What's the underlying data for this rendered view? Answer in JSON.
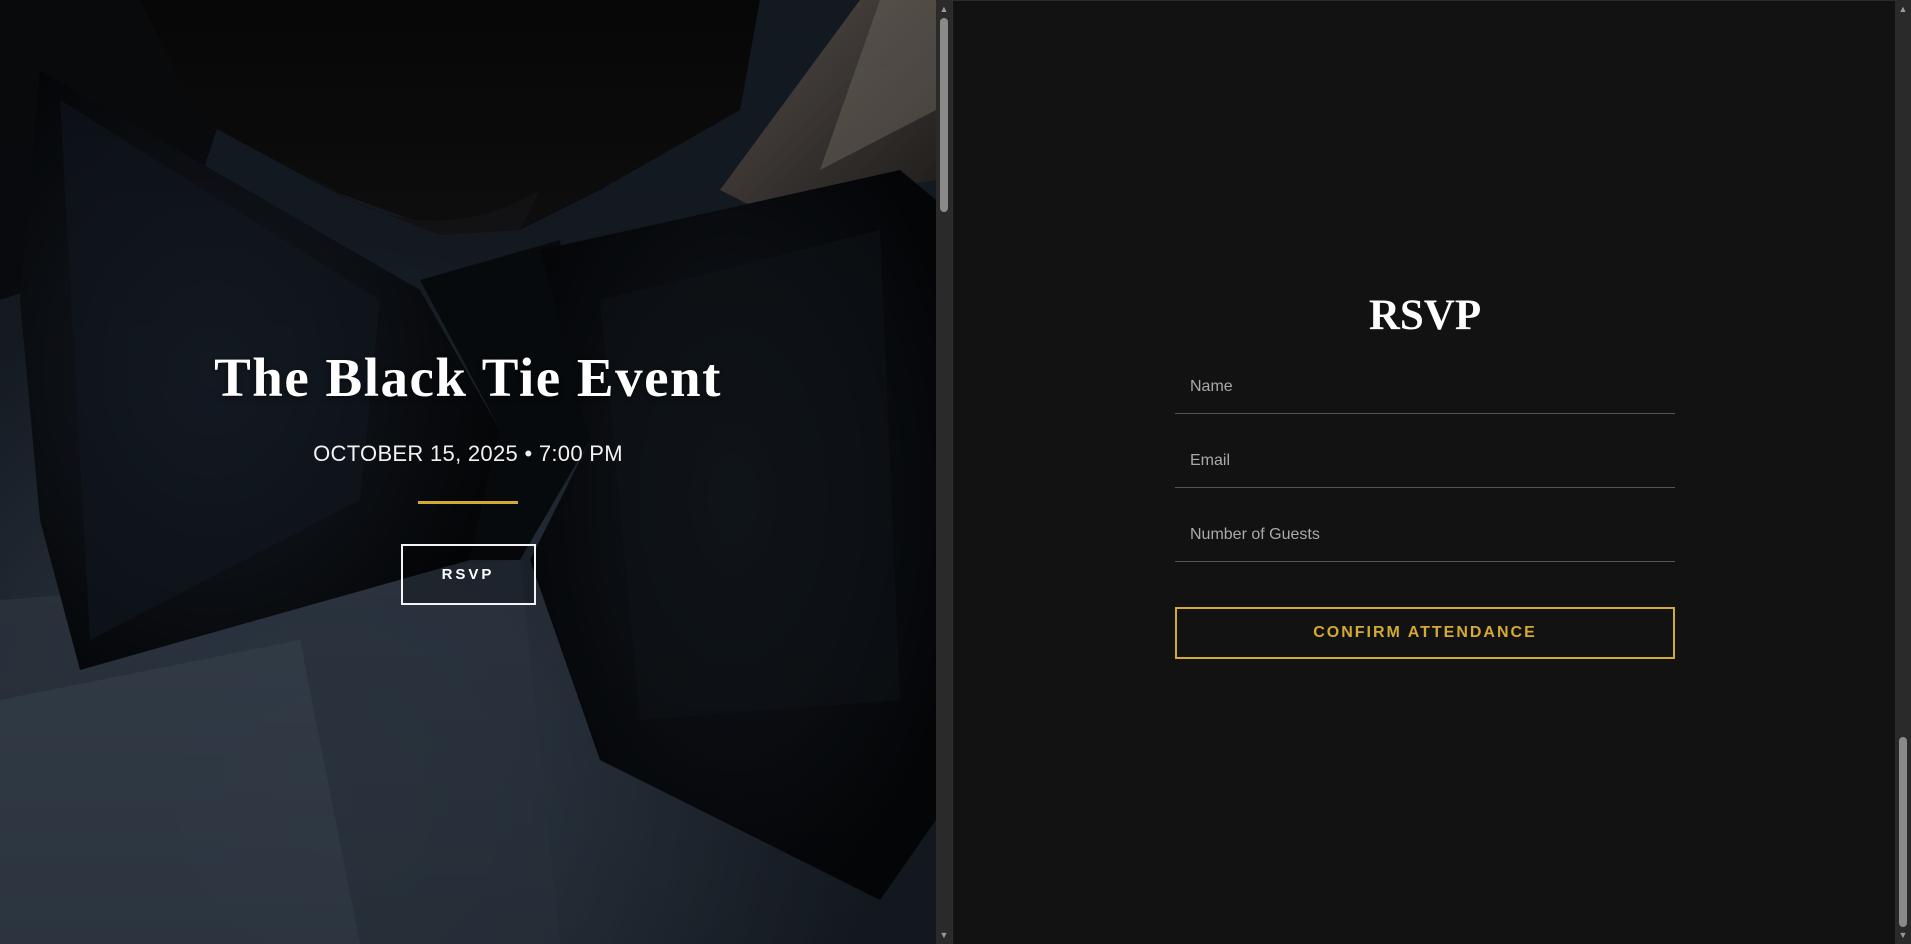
{
  "hero": {
    "title": "The Black Tie Event",
    "date": "OCTOBER 15, 2025 • 7:00 PM",
    "rsvp_button": "RSVP",
    "background_image": "bow-tie-photo"
  },
  "rsvp_form": {
    "heading": "RSVP",
    "fields": [
      {
        "name": "name",
        "placeholder": "Name",
        "value": ""
      },
      {
        "name": "email",
        "placeholder": "Email",
        "value": ""
      },
      {
        "name": "guests",
        "placeholder": "Number of Guests",
        "value": ""
      }
    ],
    "submit_label": "CONFIRM ATTENDANCE"
  },
  "colors": {
    "accent_gold": "#d4a934",
    "panel_bg": "#121212",
    "text": "#ffffff"
  },
  "icons": {
    "scroll_up": "scroll-up-arrow-icon",
    "scroll_down": "scroll-down-arrow-icon"
  }
}
